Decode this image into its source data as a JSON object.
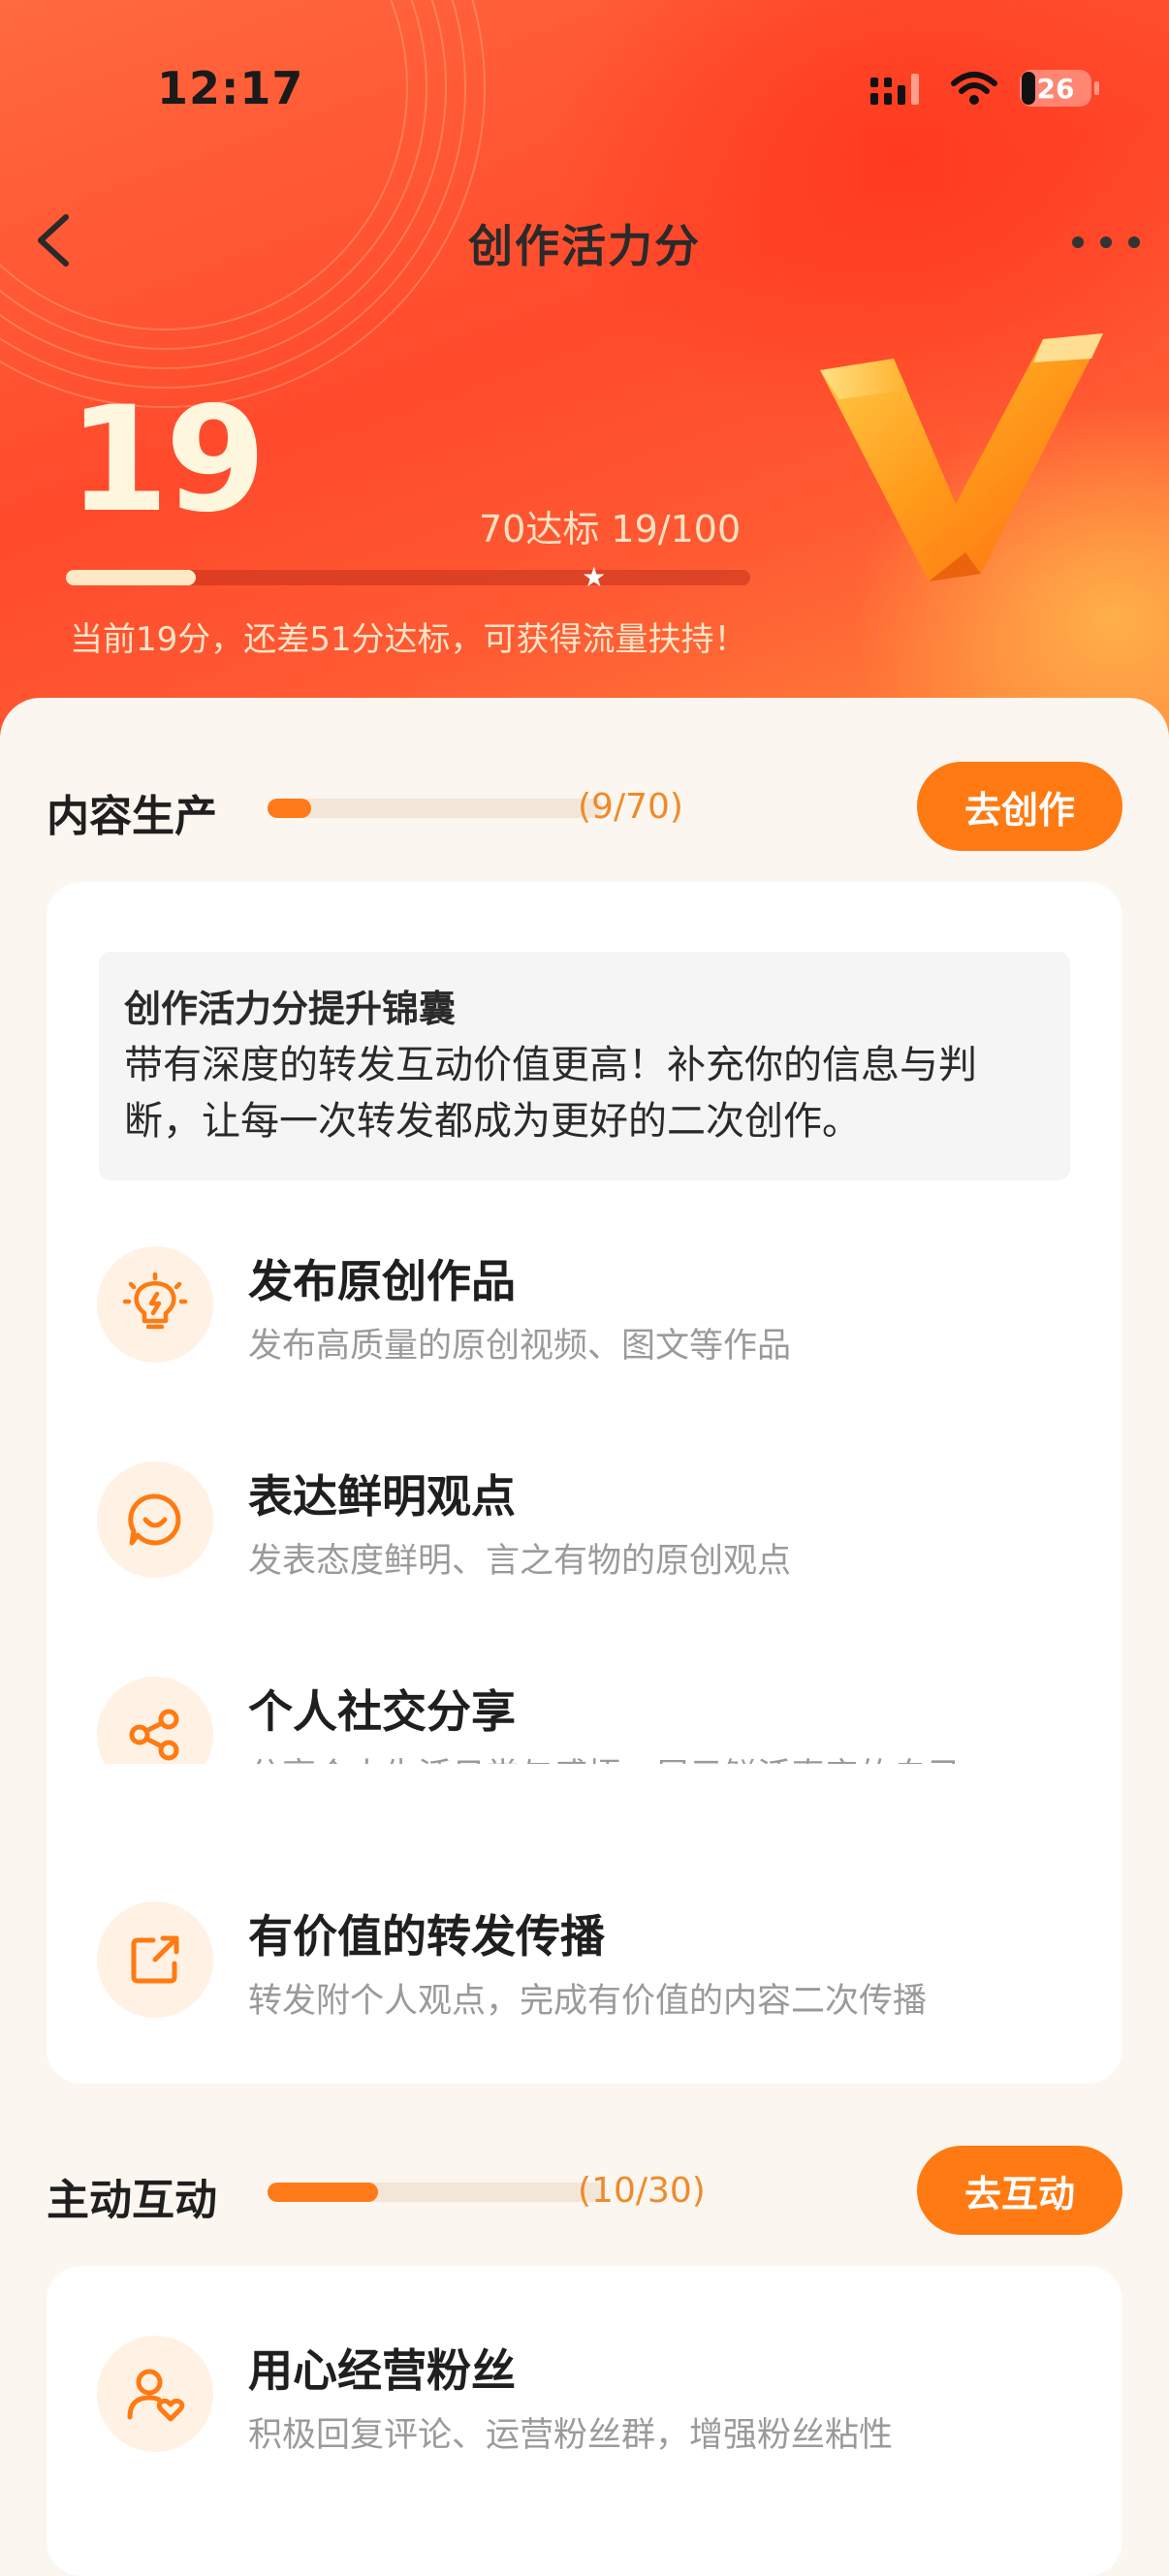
{
  "status_bar": {
    "time": "12:17",
    "battery": "26"
  },
  "nav": {
    "title": "创作活力分"
  },
  "score": {
    "value": "19",
    "target_text": "70达标 19/100",
    "progress": 0.19,
    "star_at": 0.7,
    "hint": "当前19分，还差51分达标，可获得流量扶持！"
  },
  "section_content": {
    "title": "内容生产",
    "count": "(9/70)",
    "progress": 0.13,
    "button": "去创作",
    "tip_title": "创作活力分提升锦囊",
    "tip_text": "带有深度的转发互动价值更高！补充你的信息与判断，让每一次转发都成为更好的二次创作。",
    "items": [
      {
        "icon": "lightbulb-icon",
        "title": "发布原创作品",
        "desc": "发布高质量的原创视频、图文等作品"
      },
      {
        "icon": "smile-chat-icon",
        "title": "表达鲜明观点",
        "desc": "发表态度鲜明、言之有物的原创观点"
      },
      {
        "icon": "share-icon",
        "title": "个人社交分享",
        "desc": "分享个人生活日常与感悟，展示鲜活真实的自己"
      },
      {
        "icon": "forward-icon",
        "title": "有价值的转发传播",
        "desc": "转发附个人观点，完成有价值的内容二次传播"
      }
    ]
  },
  "section_interact": {
    "title": "主动互动",
    "count": "(10/30)",
    "progress": 0.33,
    "button": "去互动",
    "items": [
      {
        "icon": "user-heart-icon",
        "title": "用心经营粉丝",
        "desc": "积极回复评论、运营粉丝群，增强粉丝粘性"
      }
    ]
  },
  "colors": {
    "accent": "#ff7a12",
    "hero_red": "#ff4a2c",
    "icon_bg": "#fff2e4"
  }
}
